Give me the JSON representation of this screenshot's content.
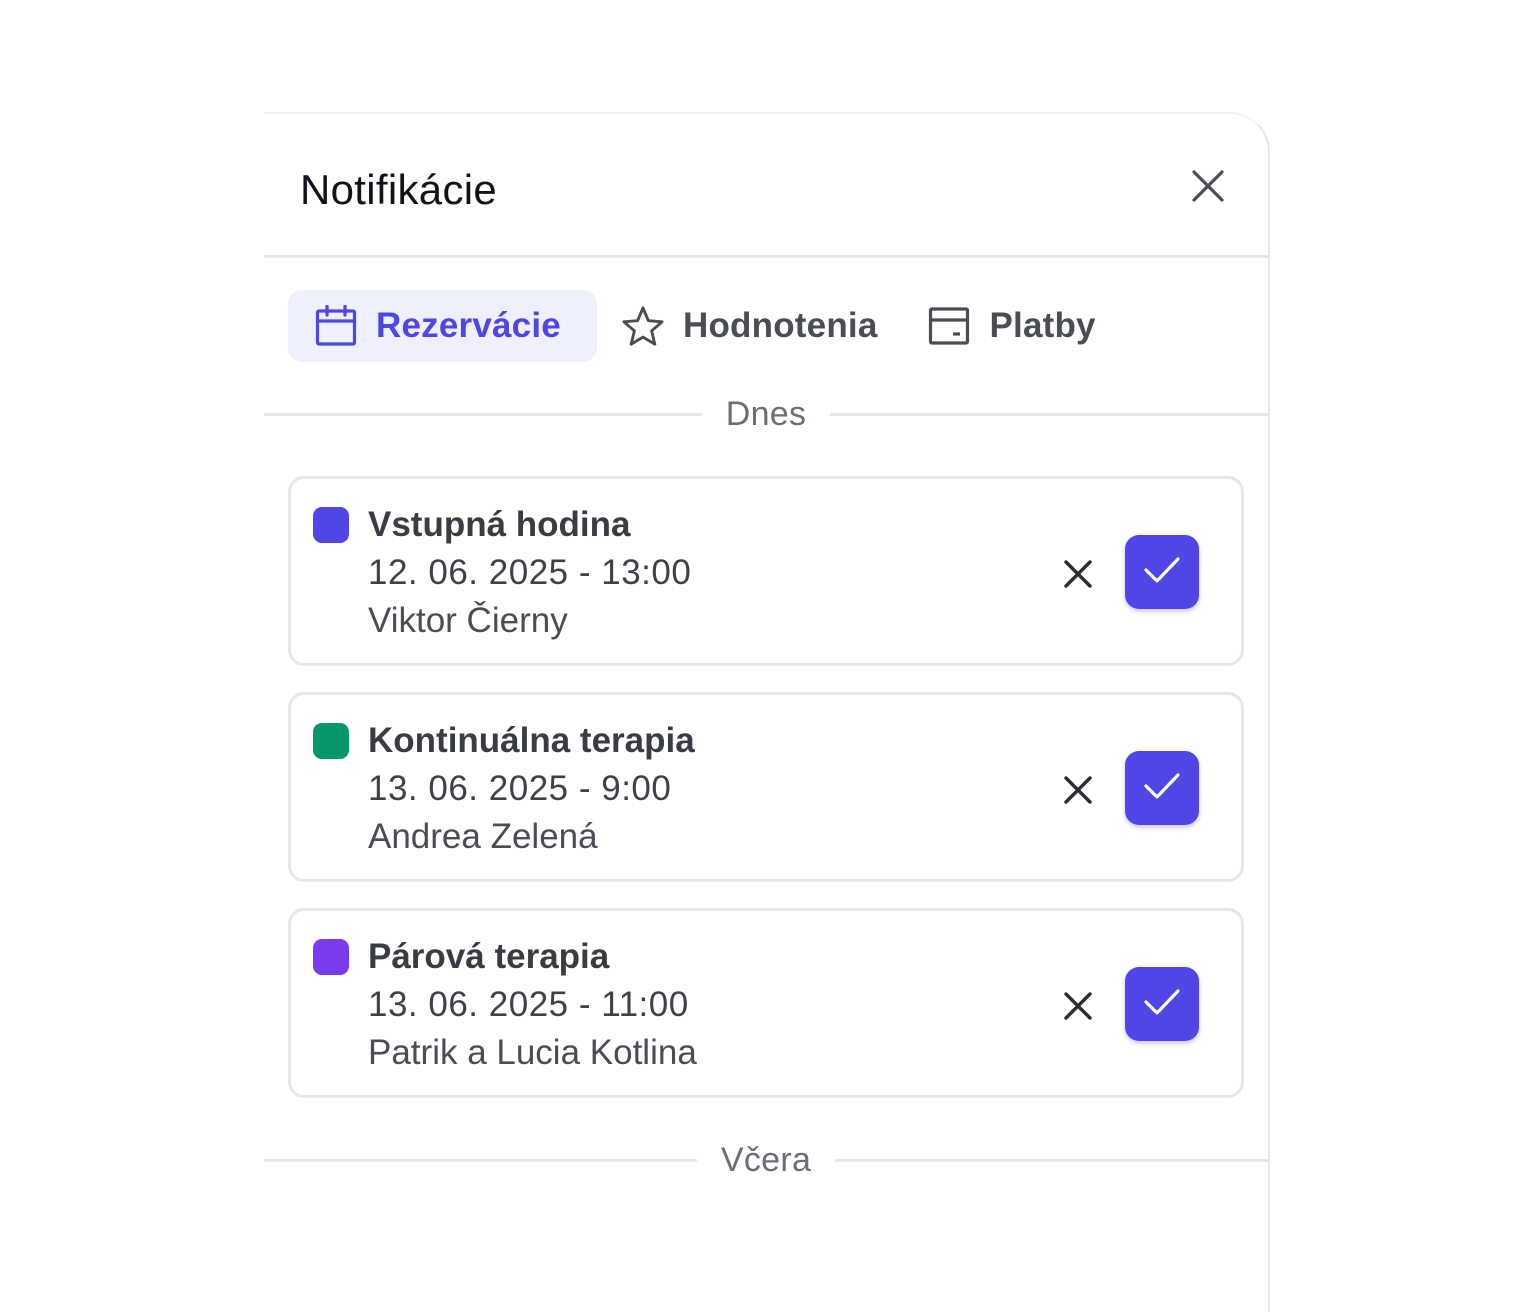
{
  "header": {
    "title": "Notifikácie",
    "close_icon": "close-icon"
  },
  "tabs": [
    {
      "label": "Rezervácie",
      "icon": "calendar-icon",
      "active": true
    },
    {
      "label": "Hodnotenia",
      "icon": "star-icon",
      "active": false
    },
    {
      "label": "Platby",
      "icon": "wallet-icon",
      "active": false
    }
  ],
  "sections": [
    {
      "label": "Dnes",
      "items": [
        {
          "title": "Vstupná hodina",
          "date": "12. 06. 2025 - 13:00",
          "person": "Viktor Čierny",
          "color": "#4f46e5"
        },
        {
          "title": "Kontinuálna terapia",
          "date": "13. 06. 2025 - 9:00",
          "person": "Andrea Zelená",
          "color": "#059669"
        },
        {
          "title": "Párová terapia",
          "date": "13. 06. 2025 - 11:00",
          "person": "Patrik a Lucia Kotlina",
          "color": "#7c3aed"
        }
      ]
    },
    {
      "label": "Včera",
      "items": []
    }
  ],
  "colors": {
    "accent": "#4f46e5",
    "active_tab_bg": "#eef0fd"
  }
}
